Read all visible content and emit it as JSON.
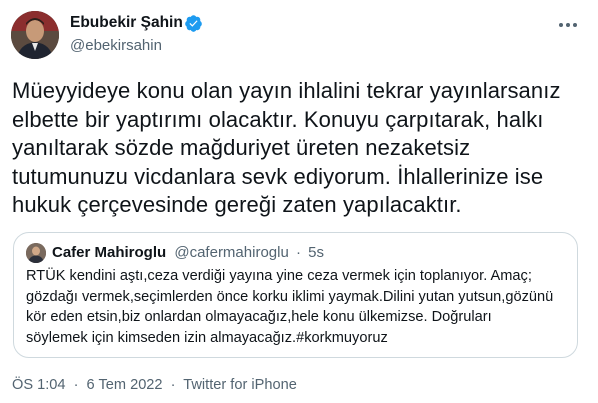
{
  "author": {
    "name": "Ebubekir Şahin",
    "handle": "@ebekirsahin",
    "verified": true,
    "avatar_icon": "profile-photo"
  },
  "tweet": {
    "text_lines": [
      "Müeyyideye konu olan yayın ihlalini tekrar yayınlarsanız",
      "elbette bir yaptırımı olacaktır. Konuyu çarpıtarak, halkı",
      "yanıltarak sözde mağduriyet üreten nezaketsiz",
      "tutumunuzu vicdanlara sevk ediyorum. İhlallerinize ise",
      "hukuk çerçevesinde gereği zaten yapılacaktır."
    ]
  },
  "quoted_tweet": {
    "name": "Cafer Mahiroglu",
    "handle": "@cafermahiroglu",
    "separator": "·",
    "time": "5s",
    "text_lines": [
      "RTÜK kendini aştı,ceza verdiği yayına yine ceza vermek için toplanıyor. Amaç;",
      "gözdağı vermek,seçimlerden önce korku iklimi yaymak.Dilini yutan yutsun,gözünü",
      "kör eden etsin,biz onlardan olmayacağız,hele konu ülkemizse. Doğruları",
      "söylemek için kimseden izin almayacağız.#korkmuyoruz"
    ]
  },
  "meta": {
    "time": "ÖS 1:04",
    "date": "6 Tem 2022",
    "separator": "·",
    "source": "Twitter for iPhone"
  },
  "colors": {
    "verified_badge": "#1d9bf0",
    "secondary_text": "#536471",
    "primary_text": "#0f1419",
    "border": "#cfd9de"
  },
  "icons": {
    "more": "more-icon",
    "verified": "verified-badge-icon"
  }
}
